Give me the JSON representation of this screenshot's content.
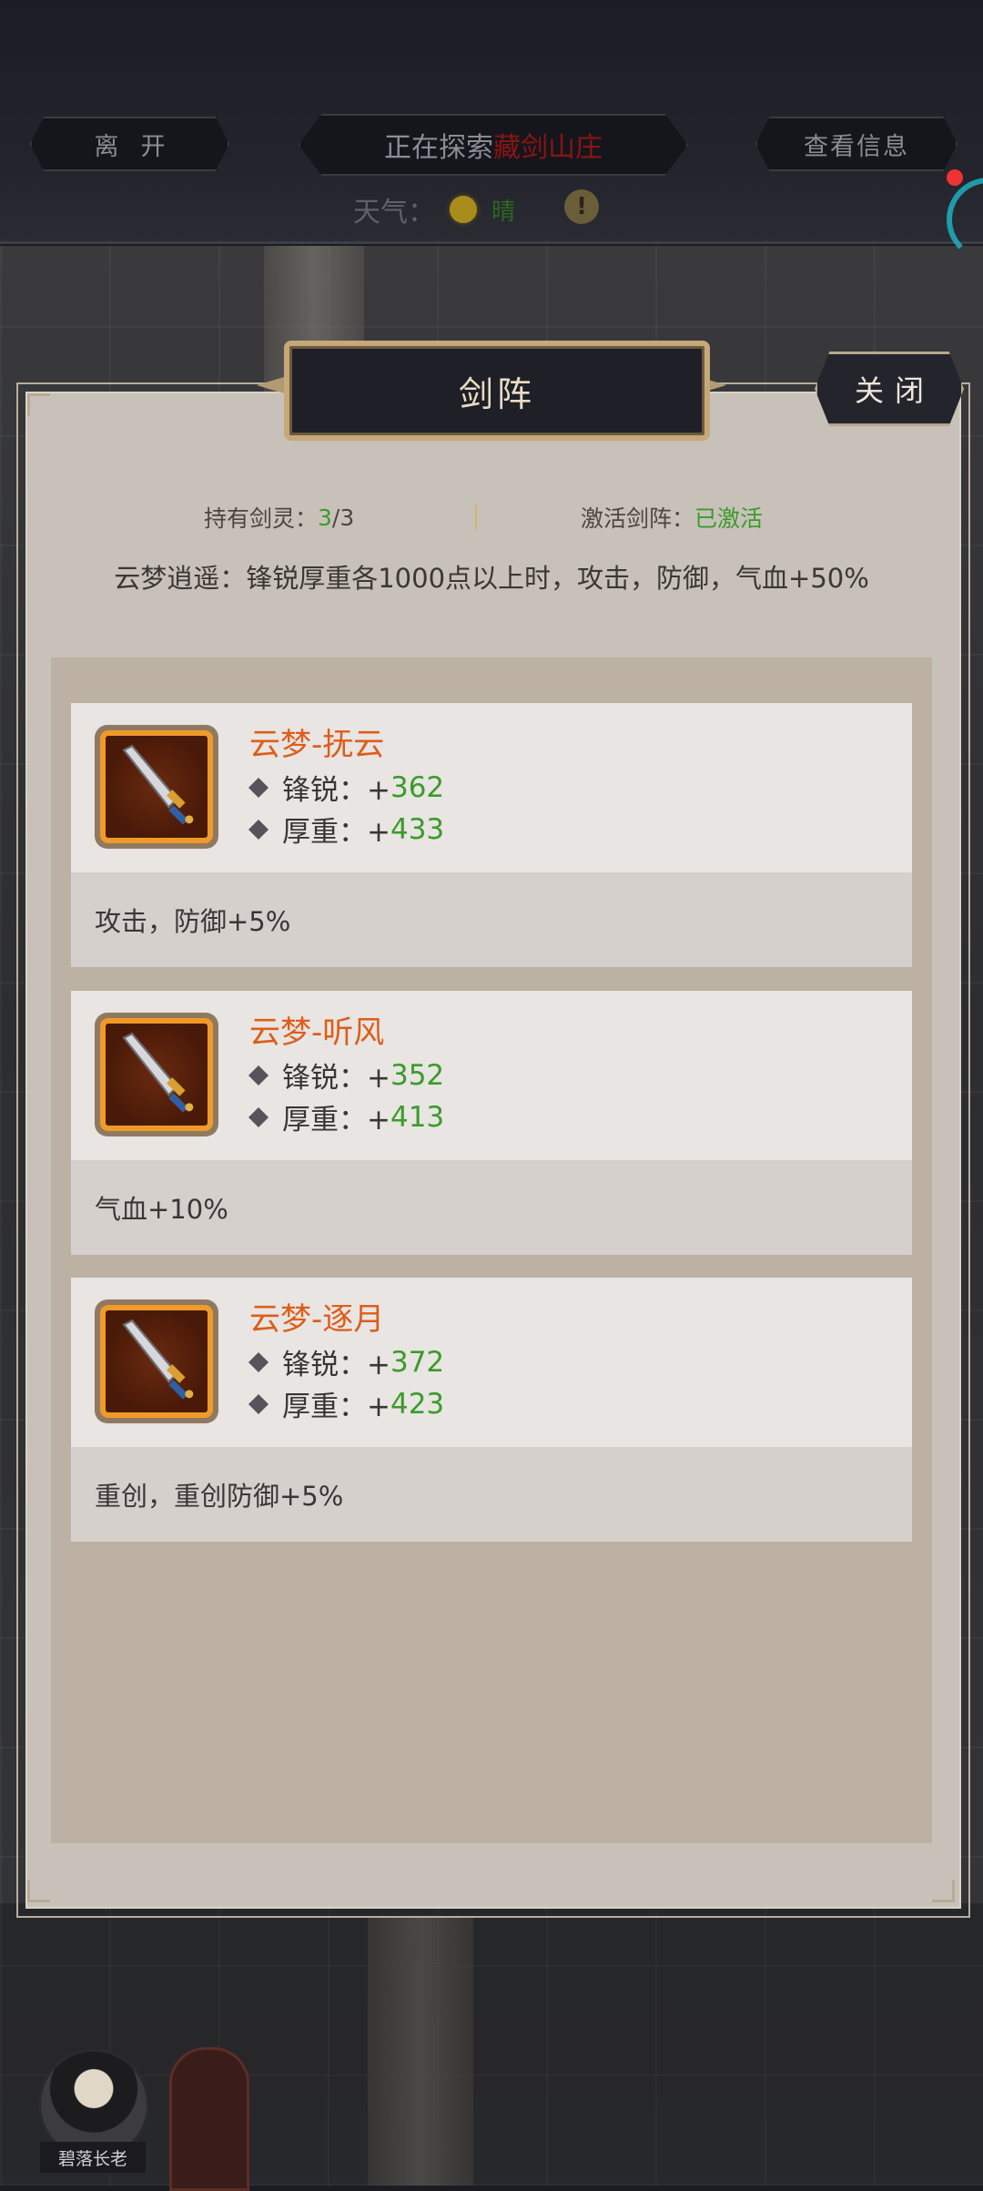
{
  "top_bar": {
    "leave_label": "离开",
    "exploring_prefix": "正在探索",
    "location": "藏剑山庄",
    "info_label": "查看信息",
    "weather_label": "天气：",
    "weather_value": "晴",
    "alert_symbol": "!"
  },
  "panel": {
    "title": "剑阵",
    "close_label": "关闭",
    "held_label": "持有剑灵：",
    "held_current": "3",
    "held_total": "/3",
    "activated_label": "激活剑阵：",
    "activated_value": "已激活",
    "bonus_desc": "云梦逍遥：锋锐厚重各1000点以上时，攻击，防御，气血+50%"
  },
  "cards": [
    {
      "name": "云梦-抚云",
      "attr1_label": "锋锐：+",
      "attr1_value": "362",
      "attr2_label": "厚重：+",
      "attr2_value": "433",
      "effect": "攻击，防御+5%"
    },
    {
      "name": "云梦-听风",
      "attr1_label": "锋锐：+",
      "attr1_value": "352",
      "attr2_label": "厚重：+",
      "attr2_value": "413",
      "effect": "气血+10%"
    },
    {
      "name": "云梦-逐月",
      "attr1_label": "锋锐：+",
      "attr1_value": "372",
      "attr2_label": "厚重：+",
      "attr2_value": "423",
      "effect": "重创，重创防御+5%"
    }
  ],
  "npc": {
    "name": "碧落长老"
  },
  "colors": {
    "accent_green": "#3c9b2a",
    "card_name_orange": "#de5d1a",
    "location_red": "#8a1414"
  },
  "icons": {
    "sword": "sword-icon",
    "diamond": "diamond-icon",
    "sun": "sun-icon"
  }
}
